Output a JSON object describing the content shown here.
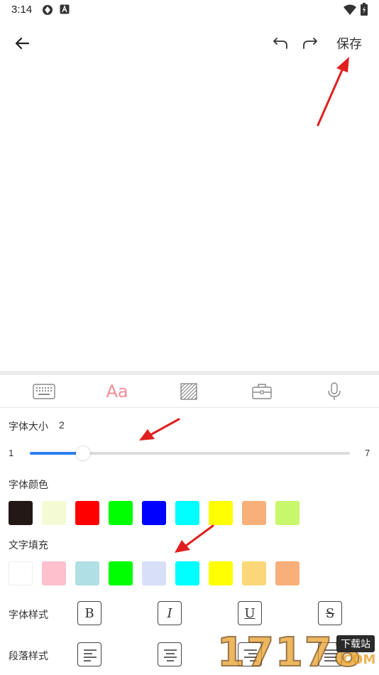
{
  "status_bar": {
    "time": "3:14"
  },
  "toolbar": {
    "back_icon": "back-arrow-icon",
    "undo_icon": "undo-icon",
    "redo_icon": "redo-icon",
    "save_label": "保存"
  },
  "tabs": [
    {
      "name": "keyboard",
      "icon": "keyboard-icon",
      "active": false
    },
    {
      "name": "font",
      "label": "Aa",
      "active": true
    },
    {
      "name": "texture",
      "icon": "texture-icon",
      "active": false
    },
    {
      "name": "tools",
      "icon": "toolbox-icon",
      "active": false
    },
    {
      "name": "voice",
      "icon": "microphone-icon",
      "active": false
    }
  ],
  "font_size": {
    "label": "字体大小",
    "value": "2",
    "min_label": "1",
    "max_label": "7",
    "fraction": 0.167
  },
  "font_color": {
    "label": "字体颜色",
    "swatches": [
      "#231816",
      "#f4fbd4",
      "#ff0000",
      "#00ff00",
      "#0000ff",
      "#00ffff",
      "#ffff00",
      "#f8b07a",
      "#c9f76b"
    ]
  },
  "text_fill": {
    "label": "文字填充",
    "swatches": [
      "#ffffff",
      "#fdc0cc",
      "#b0dfe4",
      "#00ff00",
      "#d8e0f8",
      "#00ffff",
      "#ffff00",
      "#fcd77a",
      "#f8b07a"
    ]
  },
  "font_style": {
    "label": "字体样式",
    "buttons": [
      "B",
      "I",
      "U",
      "S"
    ]
  },
  "paragraph_style": {
    "label": "段落样式",
    "buttons": [
      "align-left-icon",
      "align-center-icon",
      "align-right-icon",
      "align-justify-icon"
    ]
  },
  "watermark": {
    "digits": "17178",
    "badge": "下载站",
    "suffix": ".COM"
  },
  "colors": {
    "accent": "#2d7ff0",
    "active_tab": "#f28d9a",
    "annotation_arrow": "#e02020"
  }
}
